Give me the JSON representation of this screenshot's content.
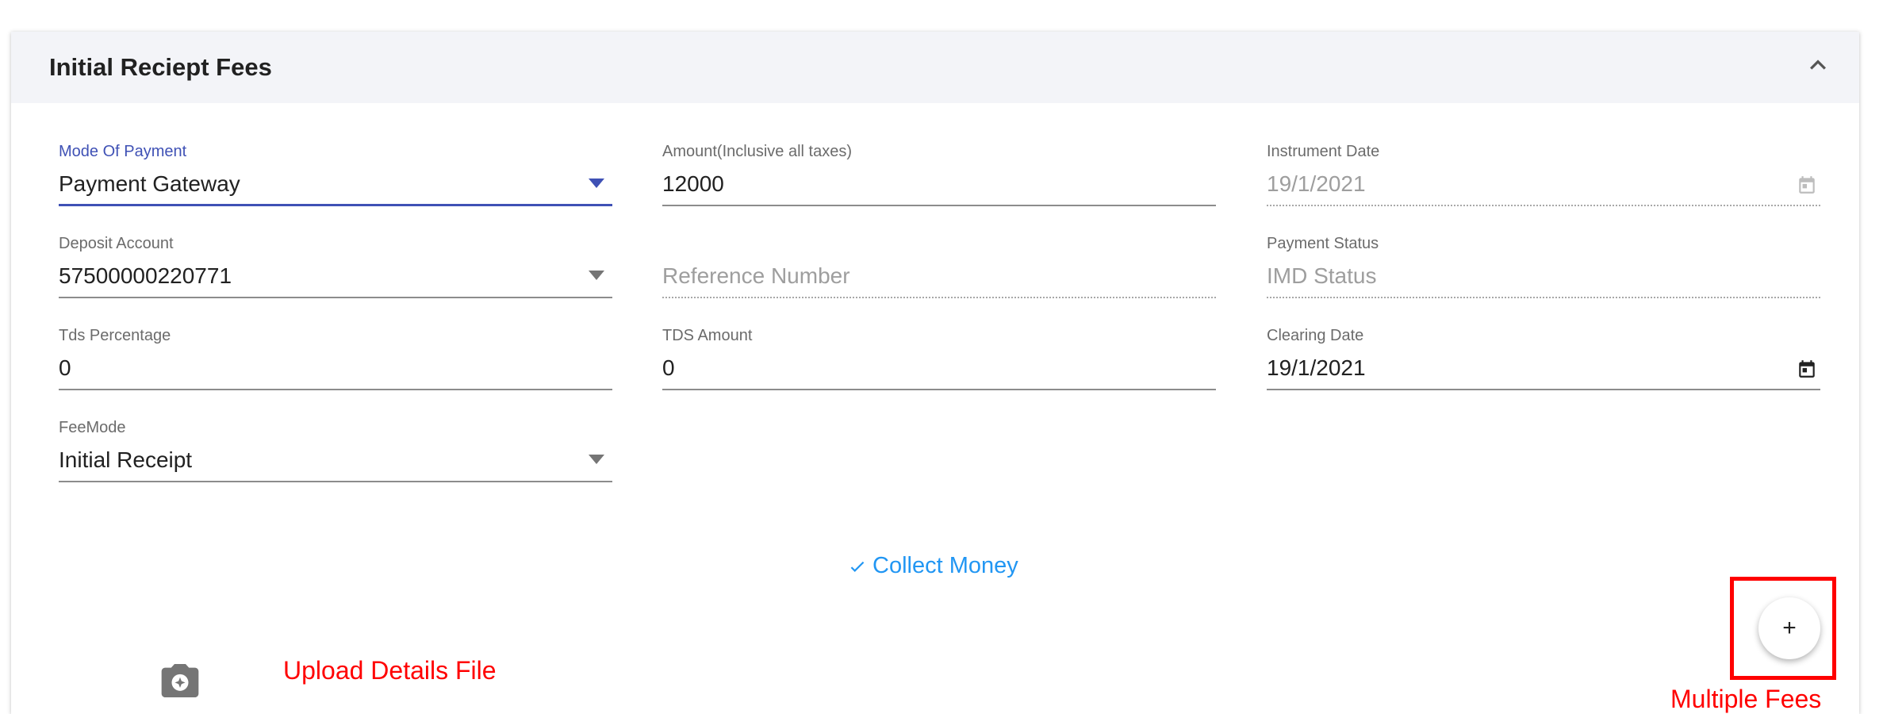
{
  "card": {
    "title": "Initial Reciept Fees"
  },
  "fields": {
    "mode_of_payment": {
      "label": "Mode Of Payment",
      "value": "Payment Gateway"
    },
    "amount": {
      "label": "Amount(Inclusive all taxes)",
      "value": "12000"
    },
    "instrument_date": {
      "label": "Instrument Date",
      "value": "19/1/2021"
    },
    "deposit_account": {
      "label": "Deposit Account",
      "value": "57500000220771"
    },
    "reference_number": {
      "placeholder": "Reference Number"
    },
    "payment_status": {
      "label": "Payment Status",
      "value": "IMD Status"
    },
    "tds_percentage": {
      "label": "Tds Percentage",
      "value": "0"
    },
    "tds_amount": {
      "label": "TDS Amount",
      "value": "0"
    },
    "clearing_date": {
      "label": "Clearing Date",
      "value": "19/1/2021"
    },
    "fee_mode": {
      "label": "FeeMode",
      "value": "Initial Receipt"
    }
  },
  "actions": {
    "collect_money": "Collect Money",
    "upload_label": "Upload Details File",
    "add_fee_symbol": "+",
    "multiple_fees_label": "Multiple Fees"
  },
  "icons": {
    "collapse": "chevron-up-icon",
    "dropdown": "caret-down-icon",
    "calendar": "calendar-icon",
    "check": "check-icon",
    "camera": "camera-icon"
  },
  "colors": {
    "accent": "#3f51b5",
    "link": "#2196f3",
    "annotation": "#ff0000",
    "header_bg": "#f3f4f8"
  }
}
